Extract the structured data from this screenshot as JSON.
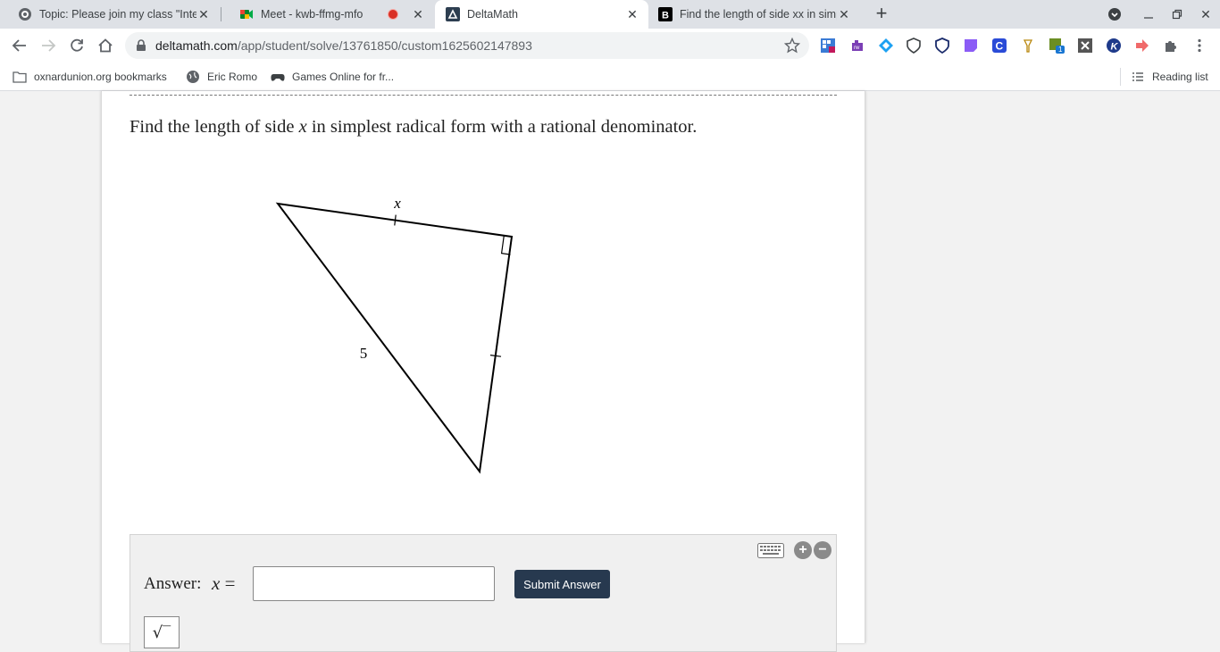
{
  "browser": {
    "tabs": [
      {
        "title": "Topic: Please join my class \"Inte",
        "favicon": "zoom-icon"
      },
      {
        "title": "Meet - kwb-ffmg-mfo",
        "favicon": "meet-icon",
        "recording": true
      },
      {
        "title": "DeltaMath",
        "favicon": "deltamath-icon",
        "active": true
      },
      {
        "title": "Find the length of side xx in simp",
        "favicon": "brainly-icon"
      }
    ],
    "url_host": "deltamath.com",
    "url_path": "/app/student/solve/13761850/custom1625602147893",
    "bookmarks": [
      {
        "label": "oxnardunion.org bookmarks",
        "icon": "folder-icon"
      },
      {
        "label": "Eric Romo",
        "icon": "globe-icon"
      },
      {
        "label": "Games Online for fr...",
        "icon": "gamepad-icon"
      }
    ],
    "reading_list": "Reading list",
    "extension_badge": "1"
  },
  "question": {
    "prefix": "Find the length of side ",
    "variable": "x",
    "suffix": " in simplest radical form with a rational denominator."
  },
  "figure": {
    "label_x": "x",
    "label_hyp": "5"
  },
  "answer": {
    "label": "Answer:",
    "variable": "x",
    "equals": "=",
    "value": "",
    "submit_label": "Submit Answer",
    "sqrt_symbol": "√‾"
  }
}
